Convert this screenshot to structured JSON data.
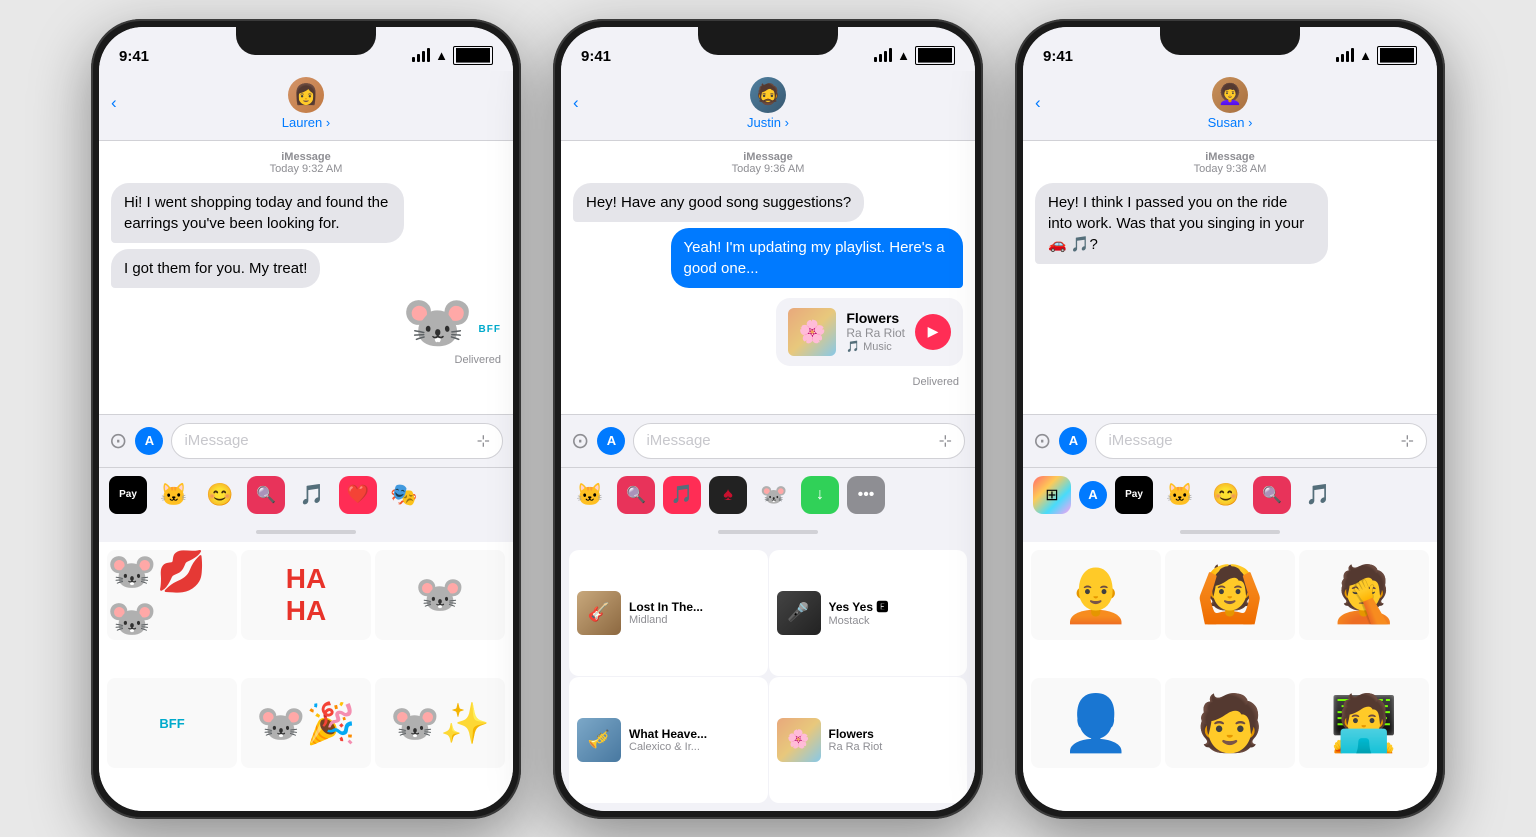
{
  "phones": [
    {
      "id": "phone-lauren",
      "time": "9:41",
      "contact": "Lauren",
      "avatar_emoji": "👩",
      "avatar_color": "#c8a070",
      "header_label": "iMessage",
      "header_time": "Today 9:32 AM",
      "messages": [
        {
          "type": "received",
          "text": "Hi! I went shopping today and found the earrings you've been looking for."
        },
        {
          "type": "received",
          "text": "I got them for you. My treat!"
        }
      ],
      "delivered": "Delivered",
      "sticker_text": "BFF",
      "input_placeholder": "iMessage",
      "tray_items": [
        "Apple Pay",
        "🐱",
        "😊",
        "🔍",
        "🎵",
        "❤️",
        "🎭"
      ],
      "tray_labels": [
        "⬛Pay",
        "🐱",
        "😊",
        "🔍",
        "🎵",
        "❤️",
        "🎭"
      ]
    },
    {
      "id": "phone-justin",
      "time": "9:41",
      "contact": "Justin",
      "avatar_emoji": "🧔",
      "avatar_color": "#708090",
      "header_label": "iMessage",
      "header_time": "Today 9:36 AM",
      "messages": [
        {
          "type": "received",
          "text": "Hey! Have any good song suggestions?"
        },
        {
          "type": "sent",
          "text": "Yeah! I'm updating my playlist. Here's a good one..."
        }
      ],
      "music_card": {
        "title": "Flowers",
        "artist": "Ra Ra Riot",
        "source": "Apple Music"
      },
      "delivered": "Delivered",
      "input_placeholder": "iMessage",
      "music_items": [
        {
          "title": "Lost In The...",
          "artist": "Midland"
        },
        {
          "title": "Yes Yes 🅴",
          "artist": "Mostack"
        },
        {
          "title": "What Heave...",
          "artist": "Calexico & Ir..."
        },
        {
          "title": "Flowers",
          "artist": "Ra Ra Riot"
        }
      ]
    },
    {
      "id": "phone-susan",
      "time": "9:41",
      "contact": "Susan",
      "avatar_emoji": "👩‍🦱",
      "avatar_color": "#d4a060",
      "header_label": "iMessage",
      "header_time": "Today 9:38 AM",
      "messages": [
        {
          "type": "received",
          "text": "Hey! I think I passed you on the ride into work. Was that you singing in your 🚗 🎵?"
        }
      ],
      "input_placeholder": "iMessage"
    }
  ],
  "labels": {
    "back": "‹",
    "chevron": " ›",
    "imessage_placeholder": "iMessage",
    "delivered": "Delivered",
    "apple_music": "🎵 Music",
    "apple_pay": "⬛Pay"
  }
}
